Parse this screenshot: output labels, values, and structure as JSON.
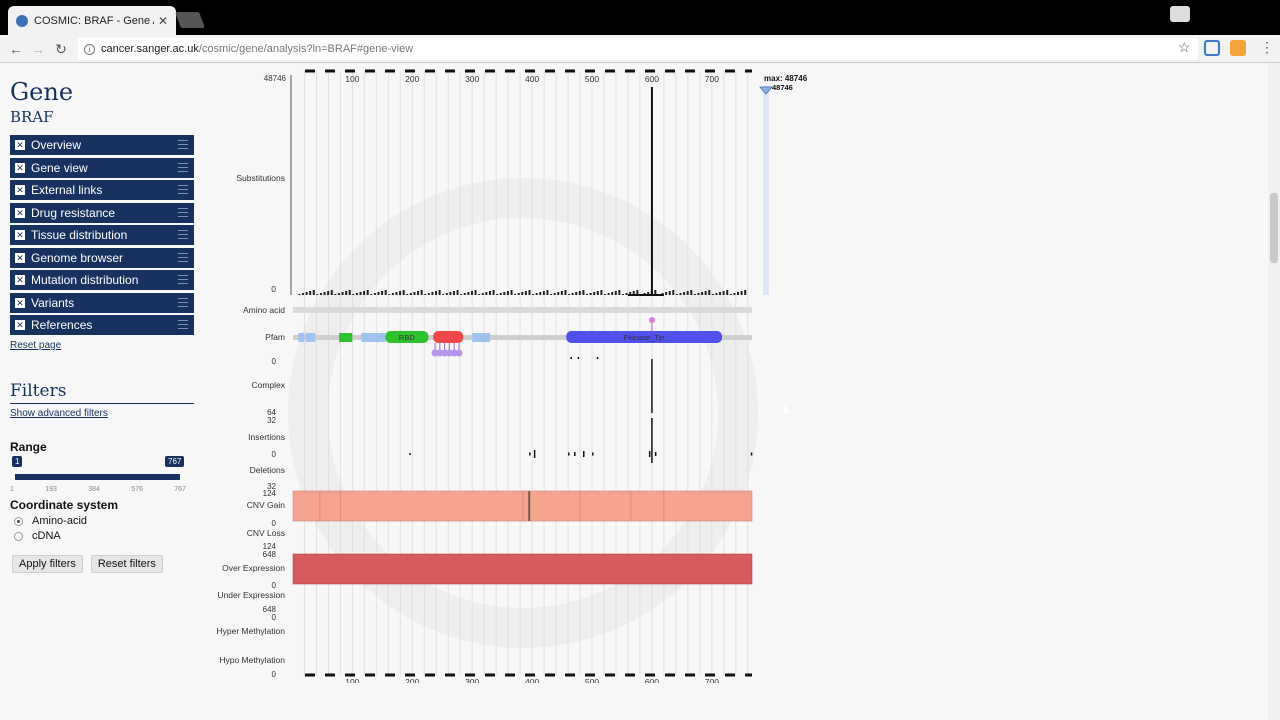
{
  "browser": {
    "tab_title": "COSMIC: BRAF - Gene Ar",
    "url_host": "cancer.sanger.ac.uk",
    "url_path": "/cosmic/gene/analysis?ln=BRAF#gene-view"
  },
  "sidebar": {
    "title": "Gene",
    "gene": "BRAF",
    "items": [
      {
        "label": "Overview"
      },
      {
        "label": "Gene view"
      },
      {
        "label": "External links"
      },
      {
        "label": "Drug resistance"
      },
      {
        "label": "Tissue distribution"
      },
      {
        "label": "Genome browser"
      },
      {
        "label": "Mutation distribution"
      },
      {
        "label": "Variants"
      },
      {
        "label": "References"
      }
    ],
    "reset_page": "Reset page"
  },
  "filters": {
    "title": "Filters",
    "advanced": "Show advanced filters",
    "range_label": "Range",
    "range_min": "1",
    "range_max": "767",
    "range_ticks": [
      "1",
      "193",
      "384",
      "576",
      "767"
    ],
    "coord_label": "Coordinate system",
    "coord_options": [
      "Amino-acid",
      "cDNA"
    ],
    "coord_selected": "Amino-acid",
    "apply": "Apply filters",
    "reset": "Reset filters"
  },
  "chart_data": {
    "type": "bar",
    "x_ticks": [
      100,
      200,
      300,
      400,
      500,
      600,
      700
    ],
    "xlim": [
      1,
      767
    ],
    "max_label": "max: 48746",
    "max_value": "48746",
    "substitutions": {
      "label": "Substitutions",
      "ymax": "48746",
      "ymin": "0",
      "peak_position": 600,
      "peak_value": 48746
    },
    "track_labels": [
      "Amino acid",
      "Pfam",
      "Complex",
      "Insertions",
      "Deletions",
      "CNV Gain",
      "CNV Loss",
      "Over Expression",
      "Under Expression",
      "Hyper Methylation",
      "Hypo Methylation"
    ],
    "axis_numbers": {
      "complex": [
        "0",
        "64"
      ],
      "insertions": [
        "32",
        "0"
      ],
      "deletions": [
        "32"
      ],
      "cnv_gain": [
        "124",
        "0"
      ],
      "cnv_loss": [
        "124"
      ],
      "over_expression": [
        "648",
        "0"
      ],
      "under_expression": [
        "648",
        "0"
      ],
      "hypo_methylation": [
        "0"
      ]
    },
    "pfam_domains": [
      {
        "name": "RBD",
        "start": 155,
        "end": 227,
        "color": "#2ec22e"
      },
      {
        "name": "",
        "start": 235,
        "end": 285,
        "color": "#f04848"
      },
      {
        "name": "Pkinase_Tyr",
        "start": 457,
        "end": 717,
        "color": "#5050ea"
      }
    ],
    "colors": {
      "cnv_gain": "#f5a48f",
      "over_expression": "#d65a5e",
      "bar": "#111111"
    }
  }
}
